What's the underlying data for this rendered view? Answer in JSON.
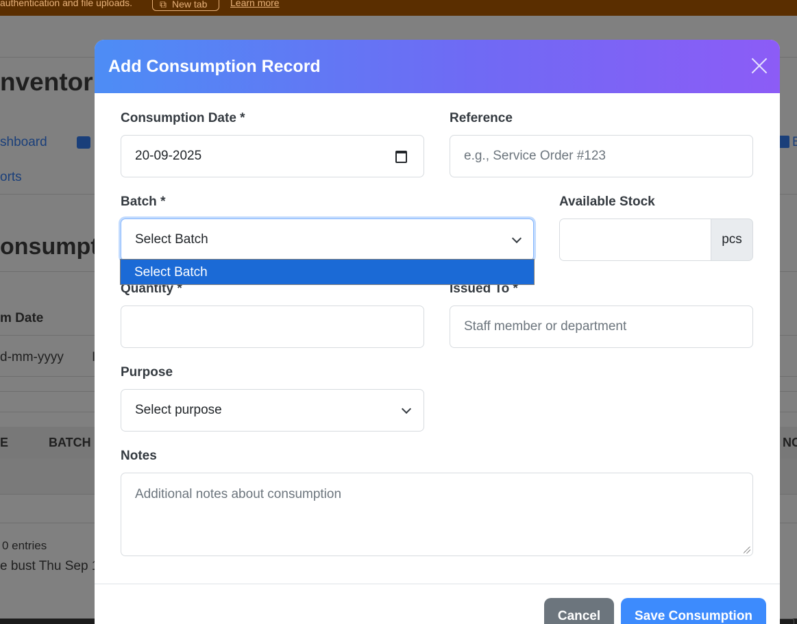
{
  "banner": {
    "text": "authentication and file uploads.",
    "new_tab_label": "New tab",
    "learn_more": "Learn more"
  },
  "background": {
    "app_title": "nventor",
    "nav": [
      "shboard",
      "orts",
      "B"
    ],
    "page_heading": "onsumpt",
    "filter_label": "m Date",
    "filter_placeholder": "d-mm-yyyy",
    "filter_cut": "I",
    "table_headers": [
      "E",
      "BATCH",
      "NO"
    ],
    "entries_text": "0 entries",
    "cache_text": "e bust Thu Sep 1"
  },
  "modal": {
    "title": "Add Consumption Record",
    "fields": {
      "consumption_date": {
        "label": "Consumption Date *",
        "value": "20-09-2025"
      },
      "reference": {
        "label": "Reference",
        "placeholder": "e.g., Service Order #123"
      },
      "batch": {
        "label": "Batch *",
        "value": "Select Batch"
      },
      "available_stock": {
        "label": "Available Stock",
        "value": "",
        "unit": "pcs"
      },
      "quantity": {
        "label": "Quantity *",
        "value": ""
      },
      "issued_to": {
        "label": "Issued To *",
        "placeholder": "Staff member or department"
      },
      "purpose": {
        "label": "Purpose",
        "value": "Select purpose"
      },
      "notes": {
        "label": "Notes",
        "placeholder": "Additional notes about consumption"
      }
    },
    "batch_dropdown_options": [
      "Select Batch"
    ],
    "buttons": {
      "cancel": "Cancel",
      "save": "Save Consumption"
    }
  },
  "colors": {
    "header_gradient_start": "#4d8df5",
    "header_gradient_end": "#8c5cf6",
    "selected_option": "#1b6ad6",
    "save_button": "#3d8bfd",
    "cancel_button": "#6c757d"
  }
}
